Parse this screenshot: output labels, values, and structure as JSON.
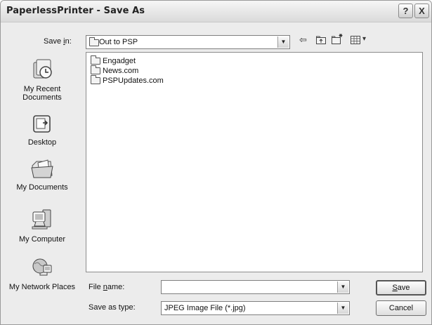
{
  "window": {
    "title": "PaperlessPrinter - Save As"
  },
  "titlebar_buttons": {
    "help": "?",
    "close": "X"
  },
  "save_in": {
    "label_before": "Save ",
    "label_accel": "i",
    "label_after": "n:",
    "value": "Out to PSP"
  },
  "toolbar": {
    "back_glyph": "⇦",
    "views_dropdown_glyph": "▾"
  },
  "places": [
    {
      "label": "My Recent Documents",
      "icon": "recent-documents-icon"
    },
    {
      "label": "Desktop",
      "icon": "desktop-icon"
    },
    {
      "label": "My Documents",
      "icon": "my-documents-icon"
    },
    {
      "label": "My Computer",
      "icon": "my-computer-icon"
    },
    {
      "label": "My Network Places",
      "icon": "network-places-icon"
    }
  ],
  "files": [
    {
      "name": "Engadget",
      "icon": "folder-icon"
    },
    {
      "name": "News.com",
      "icon": "folder-icon"
    },
    {
      "name": "PSPUpdates.com",
      "icon": "folder-icon"
    }
  ],
  "file_name": {
    "label_before": "File ",
    "label_accel": "n",
    "label_after": "ame:",
    "value": ""
  },
  "save_as_type": {
    "label": "Save as type:",
    "value": "JPEG Image File (*.jpg)"
  },
  "buttons": {
    "save_accel": "S",
    "save_rest": "ave",
    "cancel": "Cancel"
  },
  "combo_arrow": "▼"
}
